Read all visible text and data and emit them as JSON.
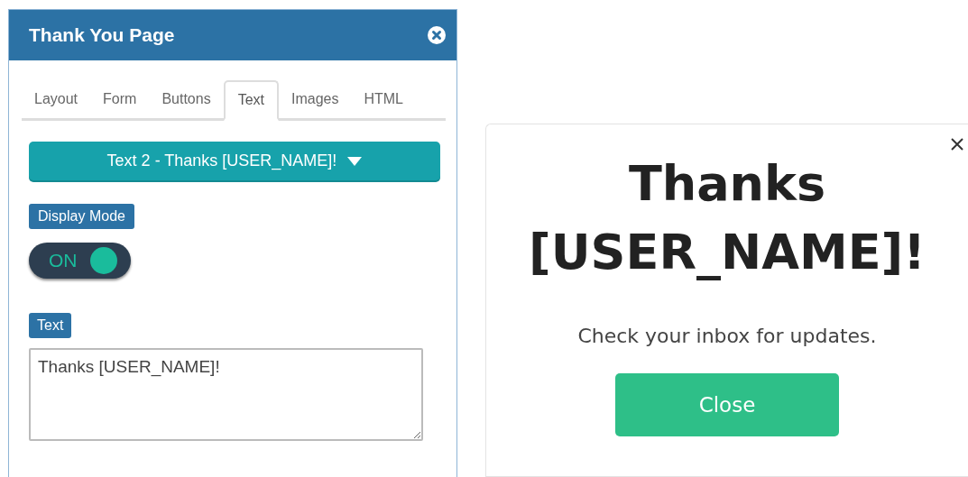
{
  "panel": {
    "title": "Thank You Page",
    "tabs": [
      {
        "label": "Layout",
        "selected": false
      },
      {
        "label": "Form",
        "selected": false
      },
      {
        "label": "Buttons",
        "selected": false
      },
      {
        "label": "Text",
        "selected": true
      },
      {
        "label": "Images",
        "selected": false
      },
      {
        "label": "HTML",
        "selected": false
      }
    ],
    "dropdown": {
      "value": "Text 2 - Thanks [USER_NAME]!"
    },
    "display_mode": {
      "label": "Display Mode",
      "on": true,
      "state_label": "ON"
    },
    "text_field": {
      "label": "Text",
      "value": "Thanks [USER_NAME]!"
    }
  },
  "preview": {
    "heading": "Thanks [USER_NAME]!",
    "message": "Check your inbox for updates.",
    "button": "Close"
  }
}
